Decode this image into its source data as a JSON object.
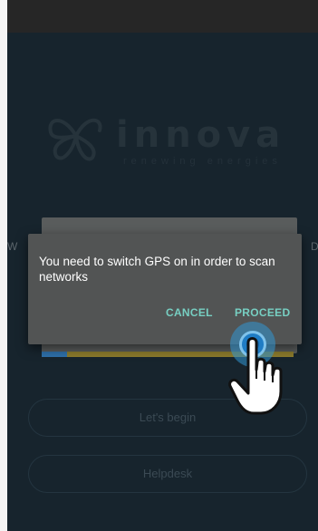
{
  "app": {
    "brand_name": "innova",
    "tagline": "renewing energies",
    "side_left_char": "W",
    "side_right_char": "D"
  },
  "dialog": {
    "message": "You need to switch GPS on in order to scan networks",
    "cancel_label": "CANCEL",
    "proceed_label": "PROCEED"
  },
  "buttons": {
    "begin_label": "Let's begin",
    "helpdesk_label": "Helpdesk"
  },
  "colors": {
    "background": "#17242d",
    "dialog": "#525454",
    "accent": "#77cfc2",
    "tap_indicator": "#1f7cc4"
  },
  "icons": {
    "logo": "butterfly-logo-icon",
    "pointer": "hand-pointer-icon"
  }
}
